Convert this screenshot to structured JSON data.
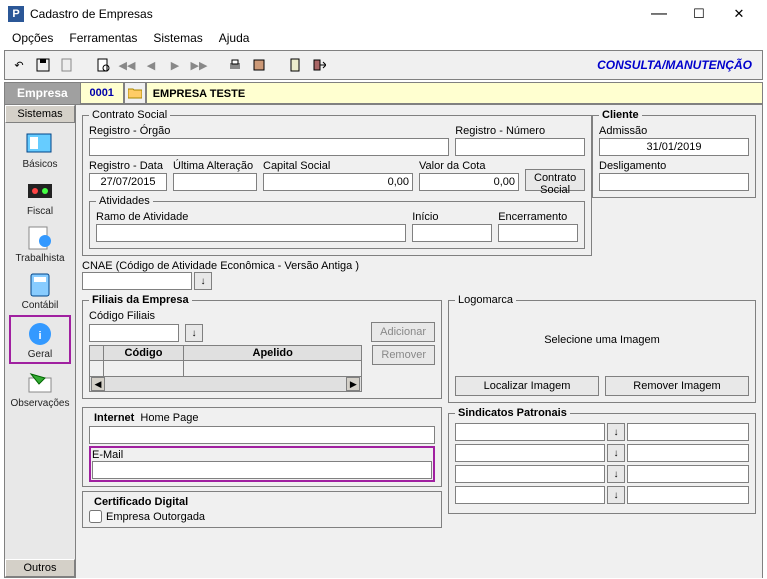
{
  "window": {
    "title": "Cadastro de Empresas"
  },
  "menu": {
    "opcoes": "Opções",
    "ferramentas": "Ferramentas",
    "sistemas": "Sistemas",
    "ajuda": "Ajuda"
  },
  "toolbar": {
    "mode": "CONSULTA/MANUTENÇÃO"
  },
  "company": {
    "tab": "Empresa",
    "code": "0001",
    "name": "EMPRESA TESTE"
  },
  "sidebar": {
    "top_tab": "Sistemas",
    "bottom_tab": "Outros",
    "items": [
      {
        "label": "Básicos"
      },
      {
        "label": "Fiscal"
      },
      {
        "label": "Trabalhista"
      },
      {
        "label": "Contábil"
      },
      {
        "label": "Geral"
      },
      {
        "label": "Observações"
      }
    ]
  },
  "contrato": {
    "legend": "Contrato Social",
    "reg_orgao_lbl": "Registro - Órgão",
    "reg_orgao": "",
    "reg_numero_lbl": "Registro - Número",
    "reg_numero": "",
    "reg_data_lbl": "Registro - Data",
    "reg_data": "27/07/2015",
    "ult_alt_lbl": "Última Alteração",
    "ult_alt": "",
    "capital_lbl": "Capital Social",
    "capital": "0,00",
    "valor_cota_lbl": "Valor da Cota",
    "valor_cota": "0,00",
    "btn": "Contrato Social",
    "atividades_legend": "Atividades",
    "ramo_lbl": "Ramo de Atividade",
    "ramo": "",
    "inicio_lbl": "Início",
    "inicio": "",
    "encerr_lbl": "Encerramento",
    "encerr": ""
  },
  "cliente": {
    "legend": "Cliente",
    "admissao_lbl": "Admissão",
    "admissao": "31/01/2019",
    "deslig_lbl": "Desligamento",
    "deslig": ""
  },
  "cnae": {
    "label": "CNAE (Código de Atividade Econômica - Versão Antiga )",
    "value": ""
  },
  "filiais": {
    "legend": "Filiais da Empresa",
    "codigo_lbl": "Código Filiais",
    "codigo": "",
    "add_btn": "Adicionar",
    "rem_btn": "Remover",
    "th_codigo": "Código",
    "th_apelido": "Apelido"
  },
  "logo": {
    "legend": "Logomarca",
    "placeholder": "Selecione  uma   Imagem",
    "find_btn": "Localizar Imagem",
    "rem_btn": "Remover Imagem"
  },
  "internet": {
    "legend": "Internet",
    "homepage_lbl": "Home Page",
    "homepage": "",
    "email_lbl": "E-Mail",
    "email": ""
  },
  "sind": {
    "legend": "Sindicatos Patronais"
  },
  "cert": {
    "legend": "Certificado Digital",
    "chk_lbl": "Empresa Outorgada"
  }
}
